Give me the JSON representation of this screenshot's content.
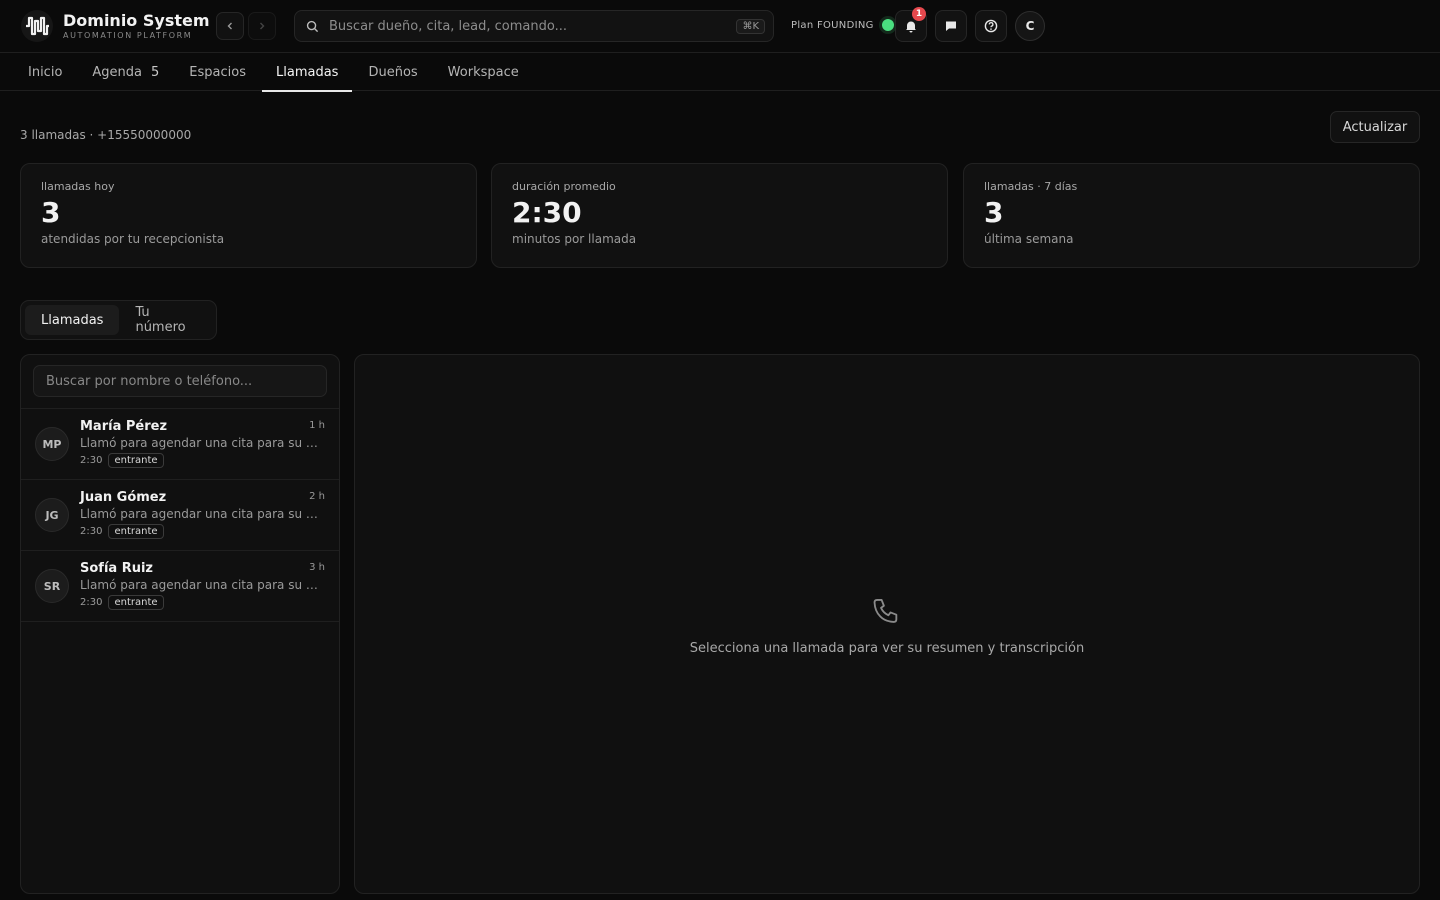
{
  "brand": {
    "title": "Dominio System",
    "subtitle": "AUTOMATION PLATFORM"
  },
  "search": {
    "placeholder": "Buscar dueño, cita, lead, comando...",
    "shortcut": "⌘K"
  },
  "plan": {
    "label": "Plan FOUNDING",
    "status_color": "#4ade80"
  },
  "notifications": {
    "count": "1"
  },
  "user": {
    "initial": "C"
  },
  "tabs": [
    {
      "label": "Inicio"
    },
    {
      "label": "Agenda",
      "count": "5"
    },
    {
      "label": "Espacios"
    },
    {
      "label": "Llamadas",
      "active": true
    },
    {
      "label": "Dueños"
    },
    {
      "label": "Workspace"
    }
  ],
  "summary": "3 llamadas · +15550000000",
  "refresh_label": "Actualizar",
  "stats": [
    {
      "label": "llamadas hoy",
      "value": "3",
      "sub": "atendidas por tu recepcionista"
    },
    {
      "label": "duración promedio",
      "value": "2:30",
      "sub": "minutos por llamada"
    },
    {
      "label": "llamadas · 7 días",
      "value": "3",
      "sub": "última semana"
    }
  ],
  "segments": [
    {
      "label": "Llamadas",
      "active": true
    },
    {
      "label": "Tu número"
    }
  ],
  "list_search": {
    "placeholder": "Buscar por nombre o teléfono..."
  },
  "calls": [
    {
      "initials": "MP",
      "name": "María Pérez",
      "time": "1 h",
      "desc": "Llamó para agendar una cita para su mascota",
      "duration": "2:30",
      "tag": "entrante"
    },
    {
      "initials": "JG",
      "name": "Juan Gómez",
      "time": "2 h",
      "desc": "Llamó para agendar una cita para su mascota",
      "duration": "2:30",
      "tag": "entrante"
    },
    {
      "initials": "SR",
      "name": "Sofía Ruiz",
      "time": "3 h",
      "desc": "Llamó para agendar una cita para su mascota",
      "duration": "2:30",
      "tag": "entrante"
    }
  ],
  "detail": {
    "empty_message": "Selecciona una llamada para ver su resumen y transcripción",
    "icon": "phone-icon"
  }
}
